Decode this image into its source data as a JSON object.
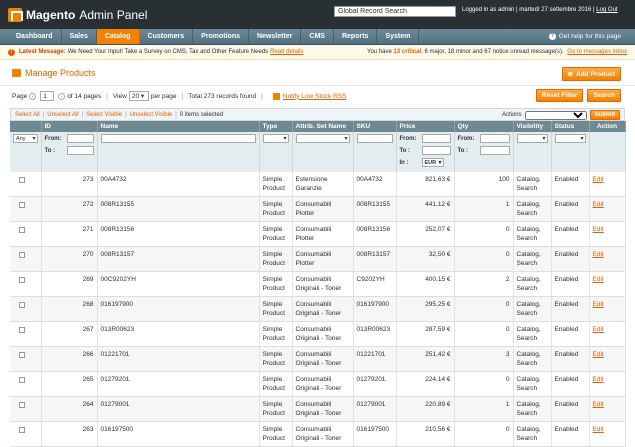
{
  "header": {
    "logo_brand": "Magento",
    "logo_text": "Admin Panel",
    "search_value": "Global Record Search",
    "logged_in": "Logged in as admin",
    "date": "martedì 27 settembre 2016",
    "logout": "Log Out"
  },
  "nav": {
    "items": [
      "Dashboard",
      "Sales",
      "Catalog",
      "Customers",
      "Promotions",
      "Newsletter",
      "CMS",
      "Reports",
      "System"
    ],
    "active": "Catalog",
    "help": "Get help for this page"
  },
  "notice": {
    "label": "Latest Message:",
    "text": "We Need Your Input! Take a Survey on CMS, Tax and Other Feature Needs",
    "link": "Read details",
    "right_pre": "You have",
    "critical": "13 critical",
    "right_mid": ", 6 major, 18 minor and 67 notice unread message(s).",
    "inbox_link": "Go to messages inbox"
  },
  "page": {
    "title": "Manage Products",
    "add_button": "Add Product"
  },
  "pager": {
    "page_label": "Page",
    "page_value": "1",
    "of_pages": "of 14 pages",
    "view_label": "View",
    "per_page_value": "20",
    "per_page_label": "per page",
    "total": "Total 273 records found",
    "rss": "Notify Low Stock RSS",
    "reset_filter": "Reset Filter",
    "search": "Search"
  },
  "massaction": {
    "select_all": "Select All",
    "unselect_all": "Unselect All",
    "select_visible": "Select Visible",
    "unselect_visible": "Unselect Visible",
    "items_selected": "0 items selected",
    "actions_label": "Actions",
    "submit": "Submit"
  },
  "columns": [
    "",
    "ID",
    "Name",
    "Type",
    "Attrib. Set Name",
    "SKU",
    "Price",
    "Qty",
    "Visibility",
    "Status",
    "Action"
  ],
  "filter": {
    "any": "Any",
    "from": "From:",
    "to": "To :",
    "in": "In :",
    "currency": "EUR"
  },
  "rows": [
    {
      "id": "273",
      "name": "00A4732",
      "type": "Simple Product",
      "attr": "Estensione Garanzie",
      "sku": "00A4732",
      "price": "821,63 €",
      "qty": "100",
      "vis": "Catalog, Search",
      "status": "Enabled",
      "action": "Edit"
    },
    {
      "id": "272",
      "name": "008R13155",
      "type": "Simple Product",
      "attr": "Consumabili Plotter",
      "sku": "008R13155",
      "price": "441,12 €",
      "qty": "1",
      "vis": "Catalog, Search",
      "status": "Enabled",
      "action": "Edit"
    },
    {
      "id": "271",
      "name": "008R13156",
      "type": "Simple Product",
      "attr": "Consumabili Plotter",
      "sku": "008R13156",
      "price": "252,07 €",
      "qty": "0",
      "vis": "Catalog, Search",
      "status": "Enabled",
      "action": "Edit"
    },
    {
      "id": "270",
      "name": "008R13157",
      "type": "Simple Product",
      "attr": "Consumabili Plotter",
      "sku": "008R13157",
      "price": "32,50 €",
      "qty": "0",
      "vis": "Catalog, Search",
      "status": "Enabled",
      "action": "Edit"
    },
    {
      "id": "269",
      "name": "00C9202YH",
      "type": "Simple Product",
      "attr": "Consumabili Originali - Toner",
      "sku": "C9202YH",
      "price": "400,15 €",
      "qty": "2",
      "vis": "Catalog, Search",
      "status": "Enabled",
      "action": "Edit"
    },
    {
      "id": "268",
      "name": "016197900",
      "type": "Simple Product",
      "attr": "Consumabili Originali - Toner",
      "sku": "016197900",
      "price": "295,25 €",
      "qty": "0",
      "vis": "Catalog, Search",
      "status": "Enabled",
      "action": "Edit"
    },
    {
      "id": "267",
      "name": "013R00623",
      "type": "Simple Product",
      "attr": "Consumabili Originali - Toner",
      "sku": "013R00623",
      "price": "287,59 €",
      "qty": "0",
      "vis": "Catalog, Search",
      "status": "Enabled",
      "action": "Edit"
    },
    {
      "id": "266",
      "name": "01221701",
      "type": "Simple Product",
      "attr": "Consumabili Originali - Toner",
      "sku": "01221701",
      "price": "251,42 €",
      "qty": "3",
      "vis": "Catalog, Search",
      "status": "Enabled",
      "action": "Edit"
    },
    {
      "id": "265",
      "name": "01279201",
      "type": "Simple Product",
      "attr": "Consumabili Originali - Toner",
      "sku": "01279201",
      "price": "224,14 €",
      "qty": "0",
      "vis": "Catalog, Search",
      "status": "Enabled",
      "action": "Edit"
    },
    {
      "id": "264",
      "name": "01279001",
      "type": "Simple Product",
      "attr": "Consumabili Originali - Toner",
      "sku": "01279001",
      "price": "220,89 €",
      "qty": "1",
      "vis": "Catalog, Search",
      "status": "Enabled",
      "action": "Edit"
    },
    {
      "id": "263",
      "name": "016197500",
      "type": "Simple Product",
      "attr": "Consumabili Originali - Toner",
      "sku": "016197500",
      "price": "210,56 €",
      "qty": "0",
      "vis": "Catalog, Search",
      "status": "Enabled",
      "action": "Edit"
    }
  ]
}
